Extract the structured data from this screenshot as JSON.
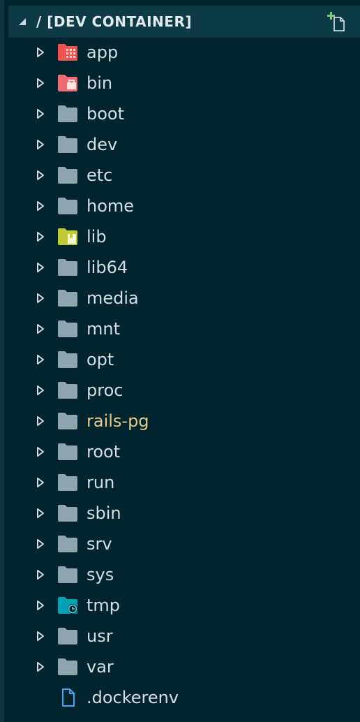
{
  "explorer": {
    "title": "/ [DEV CONTAINER]",
    "icons": {
      "collapse": "triangle-down-icon",
      "new_file": "new-file-icon"
    },
    "colors": {
      "background": "#00252f",
      "header": "#0c3a45",
      "folder": "#90a4ae",
      "folder_app": "#ef5350",
      "folder_bin": "#f06b74",
      "folder_lib": "#c0ca33",
      "folder_tmp": "#00a3b5",
      "modified_text": "#e6c98a",
      "file_icon": "#42a5f5",
      "new_file_plus": "#7bc87b"
    },
    "items": [
      {
        "label": "app",
        "type": "folder",
        "icon": "folder-app-icon"
      },
      {
        "label": "bin",
        "type": "folder",
        "icon": "folder-bin-icon"
      },
      {
        "label": "boot",
        "type": "folder",
        "icon": "folder-icon"
      },
      {
        "label": "dev",
        "type": "folder",
        "icon": "folder-icon"
      },
      {
        "label": "etc",
        "type": "folder",
        "icon": "folder-icon"
      },
      {
        "label": "home",
        "type": "folder",
        "icon": "folder-icon"
      },
      {
        "label": "lib",
        "type": "folder",
        "icon": "folder-lib-icon"
      },
      {
        "label": "lib64",
        "type": "folder",
        "icon": "folder-icon"
      },
      {
        "label": "media",
        "type": "folder",
        "icon": "folder-icon"
      },
      {
        "label": "mnt",
        "type": "folder",
        "icon": "folder-icon"
      },
      {
        "label": "opt",
        "type": "folder",
        "icon": "folder-icon"
      },
      {
        "label": "proc",
        "type": "folder",
        "icon": "folder-icon"
      },
      {
        "label": "rails-pg",
        "type": "folder",
        "icon": "folder-icon",
        "modified": true
      },
      {
        "label": "root",
        "type": "folder",
        "icon": "folder-icon"
      },
      {
        "label": "run",
        "type": "folder",
        "icon": "folder-icon"
      },
      {
        "label": "sbin",
        "type": "folder",
        "icon": "folder-icon"
      },
      {
        "label": "srv",
        "type": "folder",
        "icon": "folder-icon"
      },
      {
        "label": "sys",
        "type": "folder",
        "icon": "folder-icon"
      },
      {
        "label": "tmp",
        "type": "folder",
        "icon": "folder-tmp-icon"
      },
      {
        "label": "usr",
        "type": "folder",
        "icon": "folder-icon"
      },
      {
        "label": "var",
        "type": "folder",
        "icon": "folder-icon"
      },
      {
        "label": ".dockerenv",
        "type": "file",
        "icon": "file-icon"
      }
    ]
  }
}
